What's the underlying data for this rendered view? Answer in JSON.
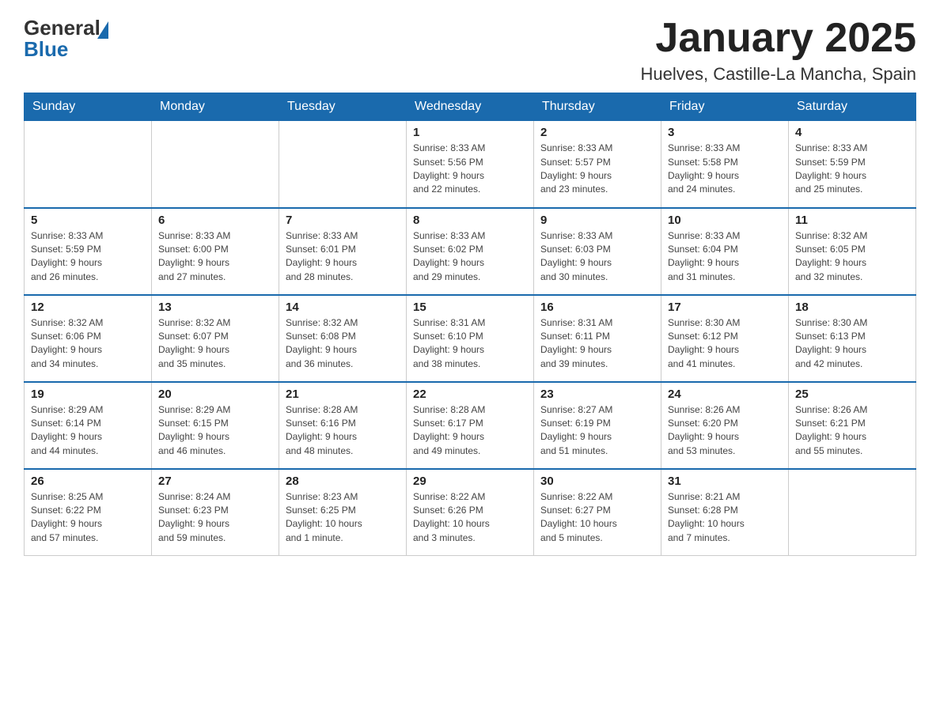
{
  "header": {
    "logo": {
      "text_general": "General",
      "text_blue": "Blue"
    },
    "month_title": "January 2025",
    "location": "Huelves, Castille-La Mancha, Spain"
  },
  "days_of_week": [
    "Sunday",
    "Monday",
    "Tuesday",
    "Wednesday",
    "Thursday",
    "Friday",
    "Saturday"
  ],
  "weeks": [
    {
      "days": [
        {
          "number": "",
          "info": ""
        },
        {
          "number": "",
          "info": ""
        },
        {
          "number": "",
          "info": ""
        },
        {
          "number": "1",
          "info": "Sunrise: 8:33 AM\nSunset: 5:56 PM\nDaylight: 9 hours\nand 22 minutes."
        },
        {
          "number": "2",
          "info": "Sunrise: 8:33 AM\nSunset: 5:57 PM\nDaylight: 9 hours\nand 23 minutes."
        },
        {
          "number": "3",
          "info": "Sunrise: 8:33 AM\nSunset: 5:58 PM\nDaylight: 9 hours\nand 24 minutes."
        },
        {
          "number": "4",
          "info": "Sunrise: 8:33 AM\nSunset: 5:59 PM\nDaylight: 9 hours\nand 25 minutes."
        }
      ]
    },
    {
      "days": [
        {
          "number": "5",
          "info": "Sunrise: 8:33 AM\nSunset: 5:59 PM\nDaylight: 9 hours\nand 26 minutes."
        },
        {
          "number": "6",
          "info": "Sunrise: 8:33 AM\nSunset: 6:00 PM\nDaylight: 9 hours\nand 27 minutes."
        },
        {
          "number": "7",
          "info": "Sunrise: 8:33 AM\nSunset: 6:01 PM\nDaylight: 9 hours\nand 28 minutes."
        },
        {
          "number": "8",
          "info": "Sunrise: 8:33 AM\nSunset: 6:02 PM\nDaylight: 9 hours\nand 29 minutes."
        },
        {
          "number": "9",
          "info": "Sunrise: 8:33 AM\nSunset: 6:03 PM\nDaylight: 9 hours\nand 30 minutes."
        },
        {
          "number": "10",
          "info": "Sunrise: 8:33 AM\nSunset: 6:04 PM\nDaylight: 9 hours\nand 31 minutes."
        },
        {
          "number": "11",
          "info": "Sunrise: 8:32 AM\nSunset: 6:05 PM\nDaylight: 9 hours\nand 32 minutes."
        }
      ]
    },
    {
      "days": [
        {
          "number": "12",
          "info": "Sunrise: 8:32 AM\nSunset: 6:06 PM\nDaylight: 9 hours\nand 34 minutes."
        },
        {
          "number": "13",
          "info": "Sunrise: 8:32 AM\nSunset: 6:07 PM\nDaylight: 9 hours\nand 35 minutes."
        },
        {
          "number": "14",
          "info": "Sunrise: 8:32 AM\nSunset: 6:08 PM\nDaylight: 9 hours\nand 36 minutes."
        },
        {
          "number": "15",
          "info": "Sunrise: 8:31 AM\nSunset: 6:10 PM\nDaylight: 9 hours\nand 38 minutes."
        },
        {
          "number": "16",
          "info": "Sunrise: 8:31 AM\nSunset: 6:11 PM\nDaylight: 9 hours\nand 39 minutes."
        },
        {
          "number": "17",
          "info": "Sunrise: 8:30 AM\nSunset: 6:12 PM\nDaylight: 9 hours\nand 41 minutes."
        },
        {
          "number": "18",
          "info": "Sunrise: 8:30 AM\nSunset: 6:13 PM\nDaylight: 9 hours\nand 42 minutes."
        }
      ]
    },
    {
      "days": [
        {
          "number": "19",
          "info": "Sunrise: 8:29 AM\nSunset: 6:14 PM\nDaylight: 9 hours\nand 44 minutes."
        },
        {
          "number": "20",
          "info": "Sunrise: 8:29 AM\nSunset: 6:15 PM\nDaylight: 9 hours\nand 46 minutes."
        },
        {
          "number": "21",
          "info": "Sunrise: 8:28 AM\nSunset: 6:16 PM\nDaylight: 9 hours\nand 48 minutes."
        },
        {
          "number": "22",
          "info": "Sunrise: 8:28 AM\nSunset: 6:17 PM\nDaylight: 9 hours\nand 49 minutes."
        },
        {
          "number": "23",
          "info": "Sunrise: 8:27 AM\nSunset: 6:19 PM\nDaylight: 9 hours\nand 51 minutes."
        },
        {
          "number": "24",
          "info": "Sunrise: 8:26 AM\nSunset: 6:20 PM\nDaylight: 9 hours\nand 53 minutes."
        },
        {
          "number": "25",
          "info": "Sunrise: 8:26 AM\nSunset: 6:21 PM\nDaylight: 9 hours\nand 55 minutes."
        }
      ]
    },
    {
      "days": [
        {
          "number": "26",
          "info": "Sunrise: 8:25 AM\nSunset: 6:22 PM\nDaylight: 9 hours\nand 57 minutes."
        },
        {
          "number": "27",
          "info": "Sunrise: 8:24 AM\nSunset: 6:23 PM\nDaylight: 9 hours\nand 59 minutes."
        },
        {
          "number": "28",
          "info": "Sunrise: 8:23 AM\nSunset: 6:25 PM\nDaylight: 10 hours\nand 1 minute."
        },
        {
          "number": "29",
          "info": "Sunrise: 8:22 AM\nSunset: 6:26 PM\nDaylight: 10 hours\nand 3 minutes."
        },
        {
          "number": "30",
          "info": "Sunrise: 8:22 AM\nSunset: 6:27 PM\nDaylight: 10 hours\nand 5 minutes."
        },
        {
          "number": "31",
          "info": "Sunrise: 8:21 AM\nSunset: 6:28 PM\nDaylight: 10 hours\nand 7 minutes."
        },
        {
          "number": "",
          "info": ""
        }
      ]
    }
  ]
}
